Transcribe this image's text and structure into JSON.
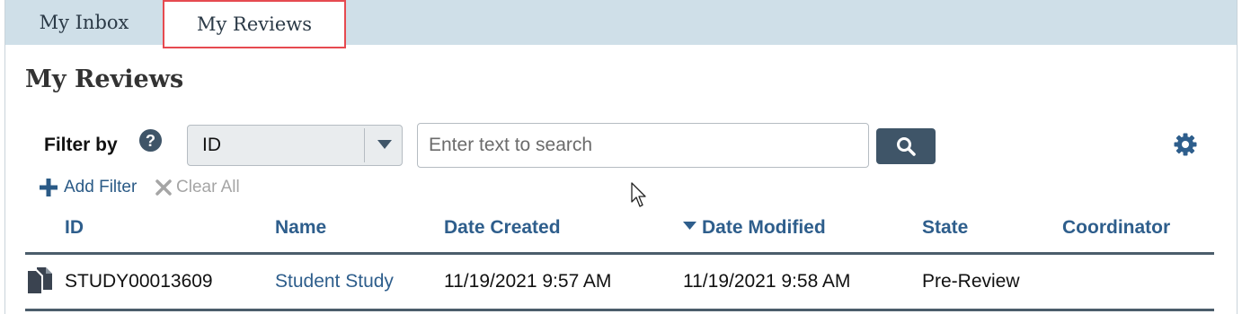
{
  "tabs": [
    {
      "label": "My Inbox"
    },
    {
      "label": "My Reviews",
      "active": true
    }
  ],
  "page_title": "My Reviews",
  "filter": {
    "label": "Filter by",
    "select_value": "ID",
    "search_placeholder": "Enter text to search",
    "add_filter_label": "Add Filter",
    "clear_all_label": "Clear All"
  },
  "table": {
    "columns": [
      "ID",
      "Name",
      "Date Created",
      "Date Modified",
      "State",
      "Coordinator"
    ],
    "sorted_column": "Date Modified",
    "sort_direction": "descending",
    "rows": [
      {
        "id": "STUDY00013609",
        "name": "Student Study",
        "date_created": "11/19/2021 9:57 AM",
        "date_modified": "11/19/2021 9:58 AM",
        "state": "Pre-Review",
        "coordinator": ""
      }
    ]
  },
  "colors": {
    "tab_bar": "#cfdfe8",
    "active_tab_outline": "#e64a50",
    "link": "#2e5e8c",
    "search_button": "#3f5568",
    "table_rule": "#4b5d6b"
  },
  "icons": [
    "help-icon",
    "chevron-down-icon",
    "search-icon",
    "gear-icon",
    "plus-icon",
    "close-icon",
    "sort-desc-icon",
    "document-icon",
    "mouse-cursor-icon"
  ]
}
